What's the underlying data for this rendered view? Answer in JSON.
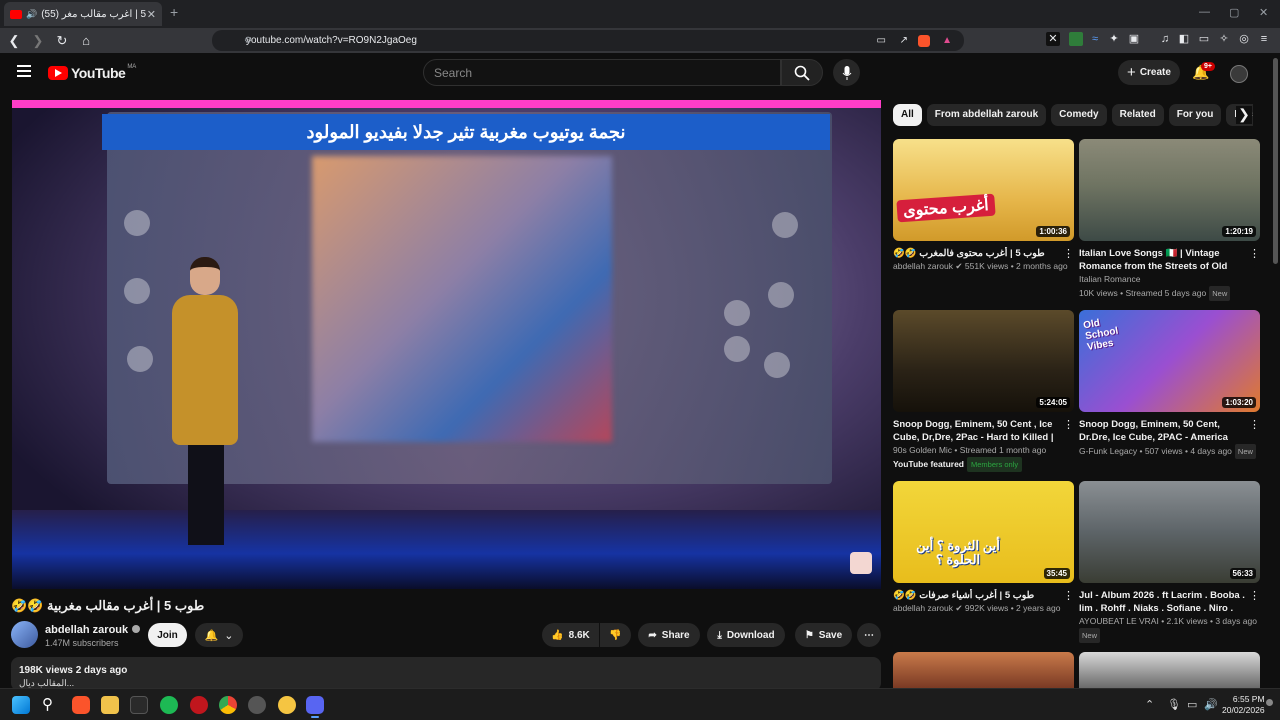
{
  "browser": {
    "tab_title": "(55) طوب 5 | أغرب مقالب مغر",
    "new_tab": "+",
    "url": "youtube.com/watch?v=RO9N2JgaOeg",
    "window_controls": [
      "—",
      "▢",
      "✕"
    ]
  },
  "header": {
    "logo": "YouTube",
    "country": "MA",
    "search_placeholder": "Search",
    "create_label": "Create",
    "notifications": "9+"
  },
  "player": {
    "banner_text": "نجمة يوتيوب مغربية تثير جدلا بفيديو المولود"
  },
  "video": {
    "title": "طوب 5 | أغرب مقالب مغربية 🤣🤣",
    "channel_name": "abdellah zarouk",
    "subscribers": "1.47M subscribers",
    "join_label": "Join",
    "likes": "8.6K",
    "share_label": "Share",
    "download_label": "Download",
    "save_label": "Save",
    "views_date": "198K views  2 days ago",
    "description": "المقالب ديال..."
  },
  "chips": [
    "All",
    "From abdellah zarouk",
    "Comedy",
    "Related",
    "For you",
    "Recently uploaded"
  ],
  "recommendations": [
    {
      "title": "طوب 5 | أغرب محتوى فالمغرب 🤣🤣",
      "channel": "abdellah zarouk",
      "meta": "551K views • 2 months ago",
      "duration": "1:00:36",
      "badge": "",
      "thumb_overlay": "أغرب محتوى",
      "verified": true
    },
    {
      "title": "Italian Love Songs 🇮🇹 | Vintage Romance from the Streets of Old Italy",
      "channel": "Italian Romance",
      "meta": "10K views • Streamed 5 days ago",
      "duration": "1:20:19",
      "badge": "New",
      "thumb_overlay": "",
      "verified": false
    },
    {
      "title": "Snoop Dogg, Eminem, 50 Cent , Ice Cube, Dr,Dre, 2Pac - Hard to Killed | Ol...",
      "channel": "90s Golden Mic",
      "meta": "Streamed 1 month ago",
      "duration": "5:24:05",
      "badge": "",
      "extra": "YouTube featured",
      "members": "Members only",
      "thumb_overlay": "",
      "verified": false
    },
    {
      "title": "Snoop Dogg, Eminem, 50 Cent, Dr.Dre, Ice Cube, 2PAC - America Gangsta | O...",
      "channel": "G-Funk Legacy",
      "meta": "507 views • 4 days ago",
      "duration": "1:03:20",
      "badge": "New",
      "thumb_overlay": "Old School Vibes",
      "verified": false
    },
    {
      "title": "طوب 5 | أغرب أشياء صرفات 🤣🤣",
      "channel": "abdellah zarouk",
      "meta": "992K views • 2 years ago",
      "duration": "35:45",
      "badge": "",
      "thumb_overlay": "أين الثروة ؟ أين الحلوة ؟",
      "verified": true
    },
    {
      "title": "Jul - Album 2026 . ft Lacrim . Booba . lim . Rohff . Niaks . Sofiane . Niro .",
      "channel": "AYOUBEAT LE VRAI",
      "meta": "2.1K views • 3 days ago",
      "duration": "56:33",
      "badge": "New",
      "thumb_overlay": "",
      "verified": false
    }
  ],
  "taskbar": {
    "time": "6:55 PM",
    "date": "20/02/2026"
  },
  "colors": {
    "yt_red": "#ff0000",
    "background": "#0f0f0f",
    "chip_bg": "#272727",
    "members_green": "#2ba640"
  }
}
